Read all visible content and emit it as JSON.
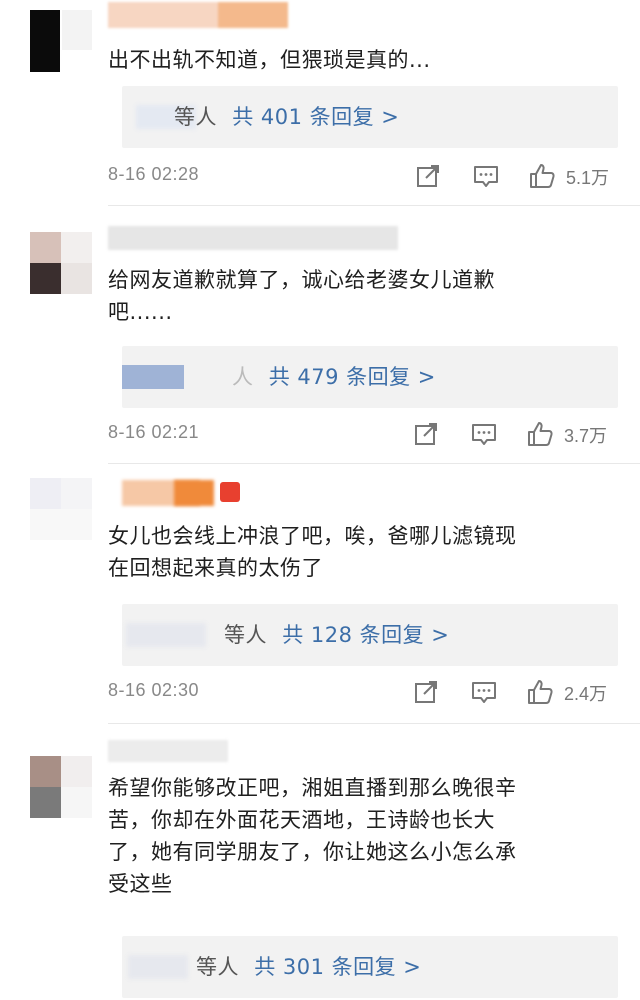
{
  "comments": [
    {
      "text": "出不出轨不知道，但猥琐是真的...",
      "replies": {
        "visible_name": "等人",
        "count_text": "共 401 条回复 >"
      },
      "time": "8-16 02:28",
      "likes": "5.1万"
    },
    {
      "text": "给网友道歉就算了，诚心给老婆女儿道歉\n吧......",
      "replies": {
        "visible_name": "人",
        "count_text": "共 479 条回复 >"
      },
      "time": "8-16 02:21",
      "likes": "3.7万"
    },
    {
      "text": "女儿也会线上冲浪了吧，唉，爸哪儿滤镜现\n在回想起来真的太伤了",
      "replies": {
        "visible_name": "等人",
        "count_text": "共 128 条回复 >"
      },
      "time": "8-16 02:30",
      "likes": "2.4万"
    },
    {
      "text": "希望你能够改正吧，湘姐直播到那么晚很辛\n苦，你却在外面花天酒地，王诗龄也长大\n了，她有同学朋友了，你让她这么小怎么承\n受这些",
      "replies": {
        "visible_name": "等人",
        "count_text": "共 301 条回复 >"
      }
    }
  ],
  "icons": {
    "share": "share-icon",
    "comment": "comment-icon",
    "like": "like-icon"
  },
  "colors": {
    "link": "#3c6ea8",
    "reply_bg": "#f2f2f2",
    "meta_text": "#888888"
  }
}
